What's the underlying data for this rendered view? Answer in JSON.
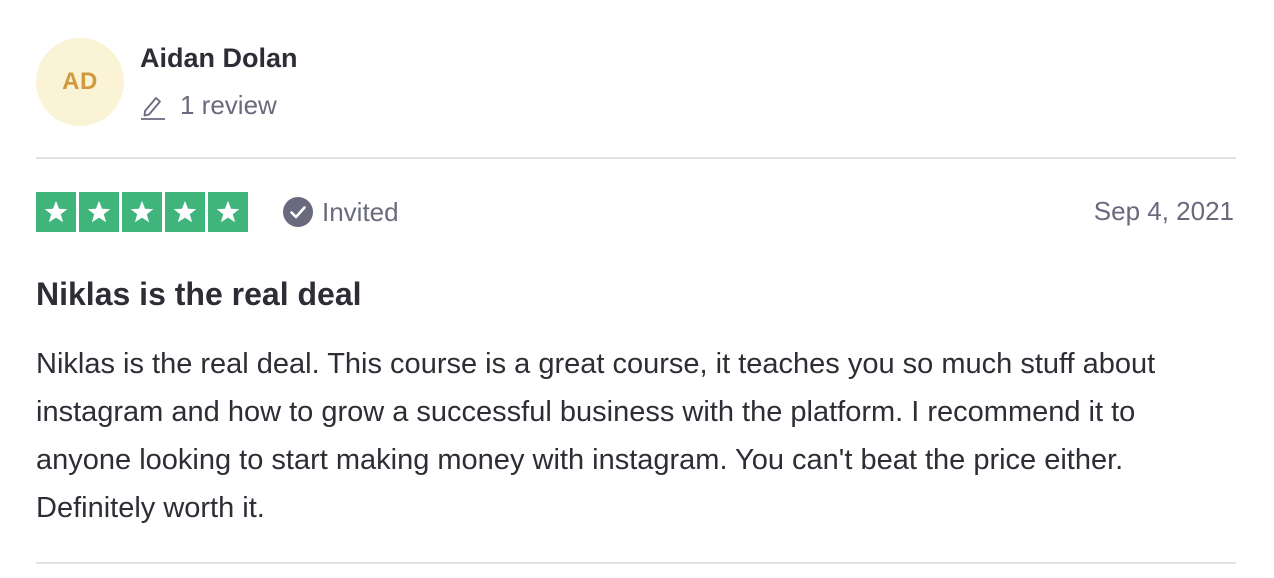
{
  "consumer": {
    "initials": "AD",
    "name": "Aidan Dolan",
    "review_count": "1 review",
    "icon": "pencil-icon"
  },
  "rating": {
    "stars": 5,
    "max_stars": 5,
    "star_color": "#3fb57c",
    "invited_label": "Invited",
    "invited_icon": "check-circle-icon",
    "date": "Sep 4, 2021"
  },
  "review": {
    "title": "Niklas is the real deal",
    "body": "Niklas is the real deal. This course is a great course, it teaches you so much stuff about instagram and how to grow a successful business with the platform. I recommend it to anyone looking to start making money with instagram. You can't beat the price either. Definitely worth it."
  },
  "colors": {
    "avatar_bg": "#fbf3d6",
    "avatar_text": "#d1993f",
    "muted_text": "#696a7d",
    "heading_text": "#2d2d35",
    "divider": "#e1e1e6"
  }
}
